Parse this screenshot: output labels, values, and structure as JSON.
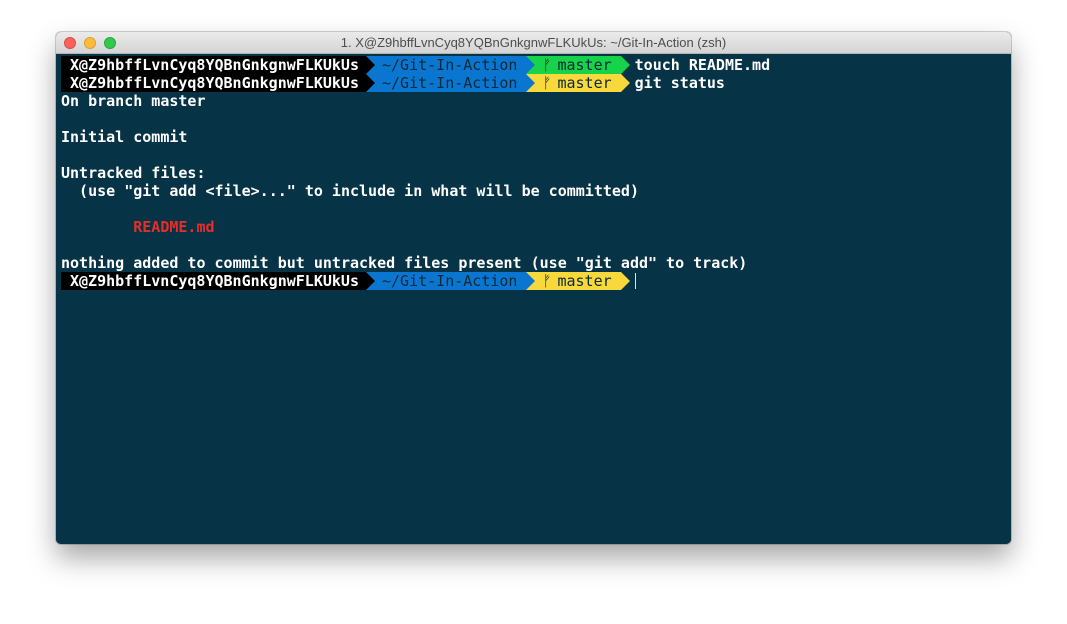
{
  "window": {
    "title": "1. X@Z9hbffLvnCyq8YQBnGnkgnwFLKUkUs: ~/Git-In-Action (zsh)"
  },
  "colors": {
    "terminal_bg": "#073347",
    "user_segment": "#000000",
    "dir_segment": "#0b76d0",
    "branch_clean": "#17d34a",
    "branch_dirty": "#f8d83a",
    "untracked_file": "#e52e29"
  },
  "prompt": {
    "user": "X@Z9hbffLvnCyq8YQBnGnkgnwFLKUkUs",
    "dir": "~/Git-In-Action",
    "branch_icon": "git-branch-icon",
    "branch_glyph": "ᚠ",
    "branch": "master"
  },
  "lines": {
    "cmd1": "touch README.md",
    "cmd2": "git status",
    "on_branch": "On branch master",
    "initial_commit": "Initial commit",
    "untracked_header": "Untracked files:",
    "untracked_hint": "  (use \"git add <file>...\" to include in what will be committed)",
    "untracked_file": "        README.md",
    "summary": "nothing added to commit but untracked files present (use \"git add\" to track)"
  }
}
